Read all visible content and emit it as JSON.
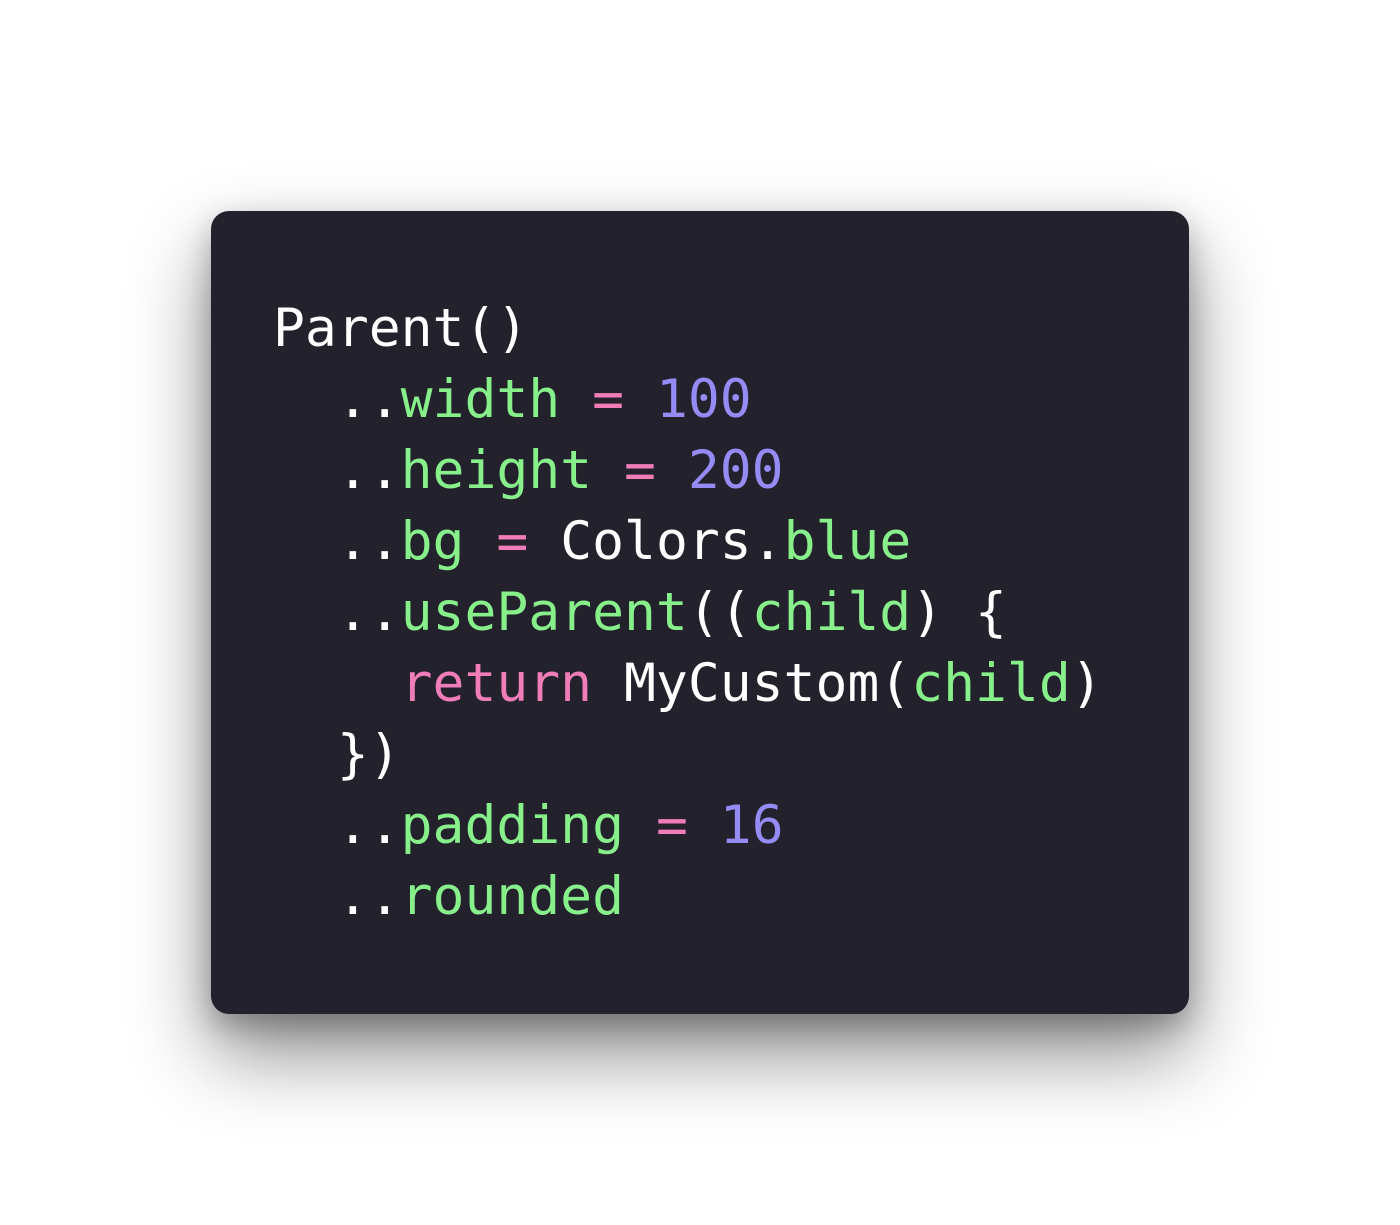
{
  "colors": {
    "background": "#ffffff",
    "editor_background": "#23222c",
    "plain": "#ffffff",
    "property": "#87f08b",
    "operator": "#f07cb8",
    "number": "#968af4",
    "keyword": "#f07cb8"
  },
  "code": {
    "lines": [
      [
        {
          "text": "Parent()",
          "kind": "plain"
        }
      ],
      [
        {
          "text": "  ..",
          "kind": "plain"
        },
        {
          "text": "width",
          "kind": "property"
        },
        {
          "text": " ",
          "kind": "plain"
        },
        {
          "text": "=",
          "kind": "operator"
        },
        {
          "text": " ",
          "kind": "plain"
        },
        {
          "text": "100",
          "kind": "number"
        }
      ],
      [
        {
          "text": "  ..",
          "kind": "plain"
        },
        {
          "text": "height",
          "kind": "property"
        },
        {
          "text": " ",
          "kind": "plain"
        },
        {
          "text": "=",
          "kind": "operator"
        },
        {
          "text": " ",
          "kind": "plain"
        },
        {
          "text": "200",
          "kind": "number"
        }
      ],
      [
        {
          "text": "  ..",
          "kind": "plain"
        },
        {
          "text": "bg",
          "kind": "property"
        },
        {
          "text": " ",
          "kind": "plain"
        },
        {
          "text": "=",
          "kind": "operator"
        },
        {
          "text": " Colors.",
          "kind": "plain"
        },
        {
          "text": "blue",
          "kind": "property"
        }
      ],
      [
        {
          "text": "  ..",
          "kind": "plain"
        },
        {
          "text": "useParent",
          "kind": "property"
        },
        {
          "text": "((",
          "kind": "plain"
        },
        {
          "text": "child",
          "kind": "property"
        },
        {
          "text": ") {",
          "kind": "plain"
        }
      ],
      [
        {
          "text": "    ",
          "kind": "plain"
        },
        {
          "text": "return",
          "kind": "keyword"
        },
        {
          "text": " MyCustom(",
          "kind": "plain"
        },
        {
          "text": "child",
          "kind": "property"
        },
        {
          "text": ")",
          "kind": "plain"
        }
      ],
      [
        {
          "text": "  })",
          "kind": "plain"
        }
      ],
      [
        {
          "text": "  ..",
          "kind": "plain"
        },
        {
          "text": "padding",
          "kind": "property"
        },
        {
          "text": " ",
          "kind": "plain"
        },
        {
          "text": "=",
          "kind": "operator"
        },
        {
          "text": " ",
          "kind": "plain"
        },
        {
          "text": "16",
          "kind": "number"
        }
      ],
      [
        {
          "text": "  ..",
          "kind": "plain"
        },
        {
          "text": "rounded",
          "kind": "property"
        }
      ]
    ]
  }
}
